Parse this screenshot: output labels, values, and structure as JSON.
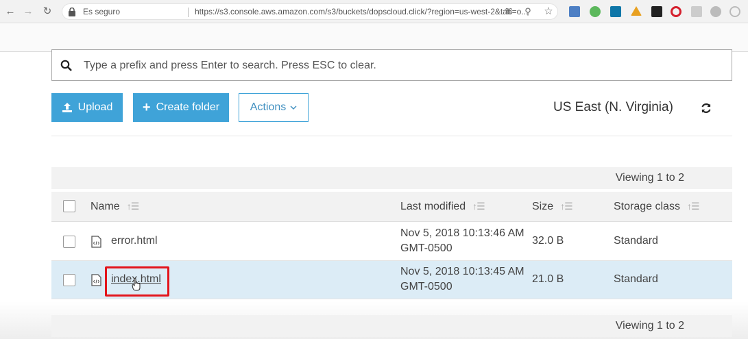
{
  "browser": {
    "secure_label": "Es seguro",
    "url": "https://s3.console.aws.amazon.com/s3/buckets/dopscloud.click/?region=us-west-2&tab=o..."
  },
  "search": {
    "placeholder": "Type a prefix and press Enter to search. Press ESC to clear."
  },
  "toolbar": {
    "upload_label": "Upload",
    "create_folder_label": "Create folder",
    "actions_label": "Actions",
    "region_label": "US East (N. Virginia)"
  },
  "viewing": {
    "top": "Viewing 1 to 2",
    "bottom": "Viewing 1 to 2"
  },
  "table": {
    "headers": {
      "name": "Name",
      "last_modified": "Last modified",
      "size": "Size",
      "storage_class": "Storage class"
    },
    "rows": [
      {
        "name": "error.html",
        "modified_line1": "Nov 5, 2018 10:13:46 AM",
        "modified_line2": "GMT-0500",
        "size": "32.0 B",
        "storage": "Standard"
      },
      {
        "name": "index.html",
        "modified_line1": "Nov 5, 2018 10:13:45 AM",
        "modified_line2": "GMT-0500",
        "size": "21.0 B",
        "storage": "Standard"
      }
    ]
  },
  "colors": {
    "primary": "#3fa3d8",
    "highlight": "#e3141b",
    "selected_row": "#dcecf6"
  }
}
